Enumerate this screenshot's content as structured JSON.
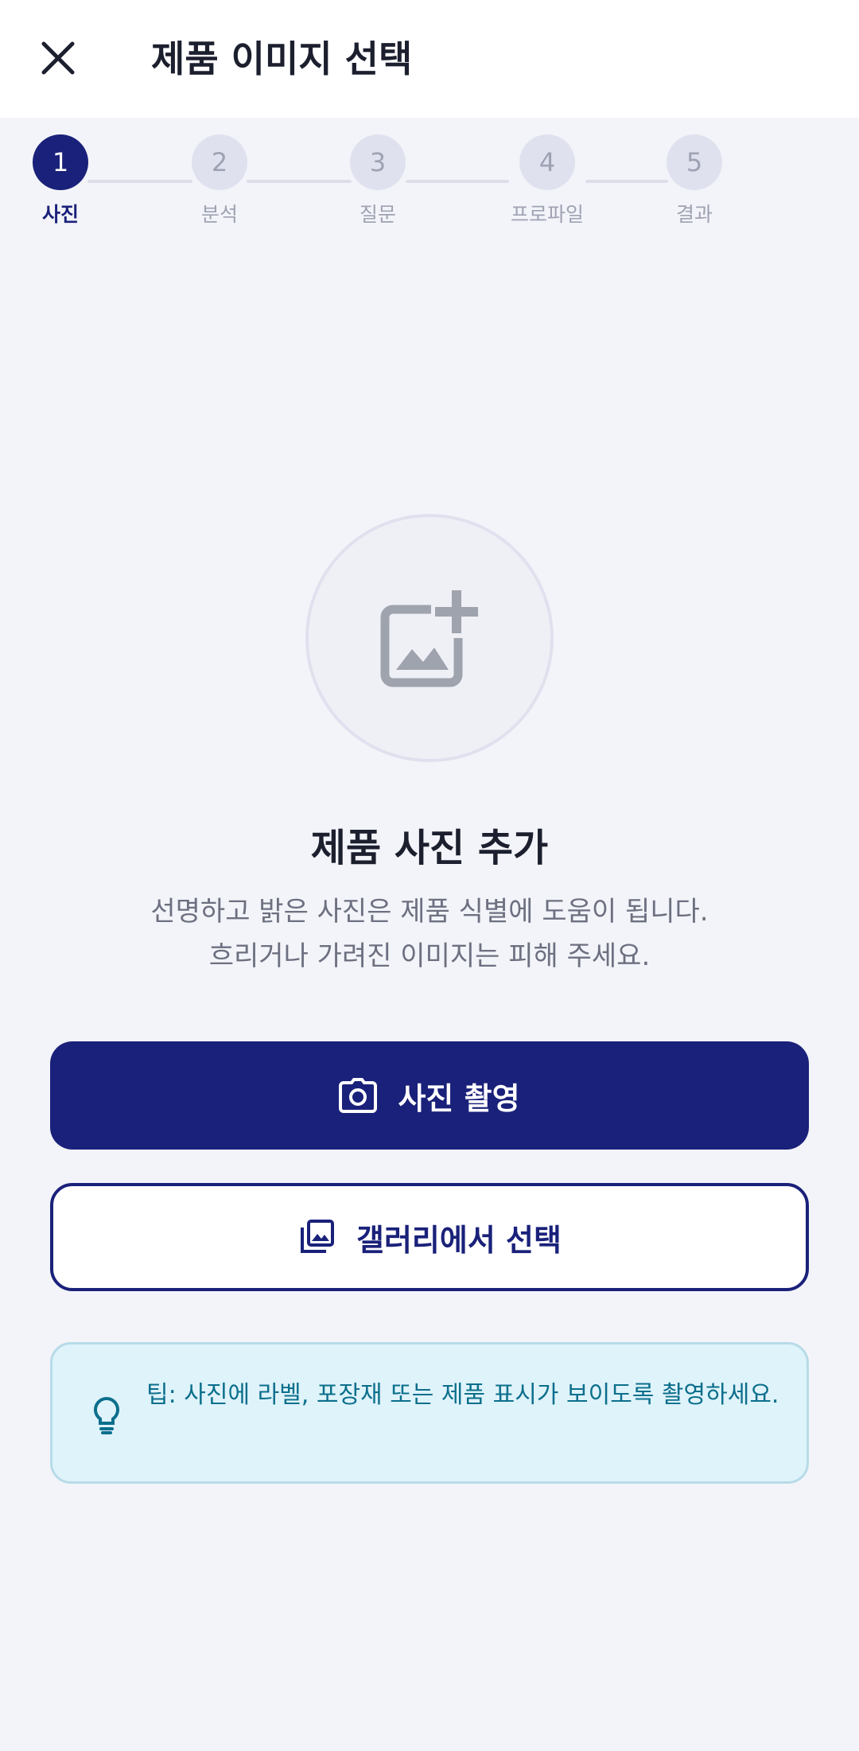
{
  "header": {
    "title": "제품 이미지 선택",
    "close_icon": "close-icon"
  },
  "stepper": {
    "steps": [
      {
        "number": "1",
        "label": "사진",
        "state": "active"
      },
      {
        "number": "2",
        "label": "분석",
        "state": "inactive"
      },
      {
        "number": "3",
        "label": "질문",
        "state": "inactive"
      },
      {
        "number": "4",
        "label": "프로파일",
        "state": "inactive"
      },
      {
        "number": "5",
        "label": "결과",
        "state": "inactive"
      }
    ]
  },
  "main": {
    "title": "제품 사진 추가",
    "description_line1": "선명하고 밝은 사진은 제품 식별에 도움이 됩니다.",
    "description_line2": "흐리거나 가려진 이미지는 피해 주세요.",
    "placeholder_icon": "add-photo-icon"
  },
  "actions": {
    "camera_label": "사진 촬영",
    "gallery_label": "갤러리에서 선택"
  },
  "tip": {
    "text": "팁: 사진에 라벨, 포장재 또는 제품 표시가 보이도록 촬영하세요."
  },
  "colors": {
    "primary": "#1a217a",
    "background": "#f3f4f9",
    "tip_background": "#dff3fa",
    "tip_text": "#0b6f8c"
  }
}
